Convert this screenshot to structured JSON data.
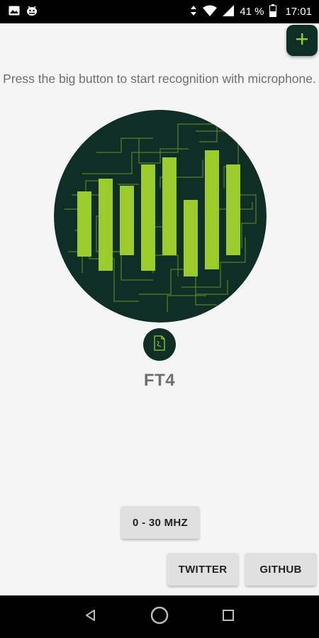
{
  "status_bar": {
    "battery": "41 %",
    "time": "17:01"
  },
  "main": {
    "instruction": "Press the big button to start recognition with microphone.",
    "mode_label": "FT4"
  },
  "buttons": {
    "frequency": "0 - 30 MHZ",
    "twitter": "TWITTER",
    "github": "GITHUB"
  },
  "colors": {
    "accent": "#9ccc2c",
    "dark": "#0f2e26",
    "background": "#f5f5f5"
  },
  "icons": {
    "fab": "plus-icon",
    "nav_back": "back-triangle-icon",
    "nav_home": "home-circle-icon",
    "nav_recents": "recents-square-icon"
  }
}
